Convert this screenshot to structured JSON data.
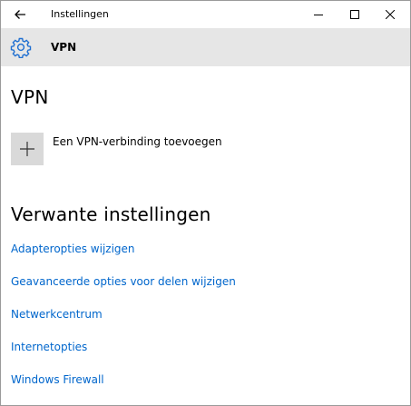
{
  "window": {
    "title": "Instellingen",
    "back_icon": "back-arrow-icon",
    "minimize_icon": "minimize-icon",
    "maximize_icon": "maximize-icon",
    "close_icon": "close-icon"
  },
  "header": {
    "icon": "gear-icon",
    "title": "VPN"
  },
  "main": {
    "title": "VPN",
    "add_connection": {
      "icon": "plus-icon",
      "label": "Een VPN-verbinding toevoegen"
    },
    "related": {
      "title": "Verwante instellingen",
      "links": [
        "Adapteropties wijzigen",
        "Geavanceerde opties voor delen wijzigen",
        "Netwerkcentrum",
        "Internetopties",
        "Windows Firewall"
      ]
    }
  },
  "colors": {
    "accent": "#0066cc",
    "header_background": "#e6e6e6",
    "tile_background": "#d9d9d9"
  }
}
